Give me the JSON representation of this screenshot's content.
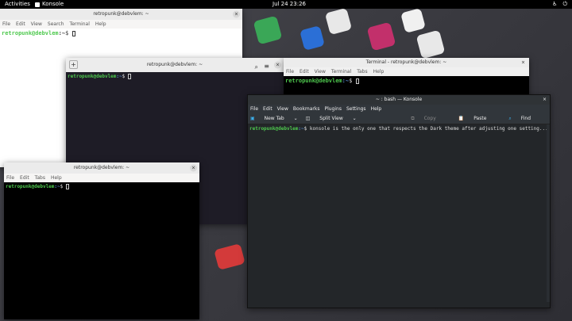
{
  "topbar": {
    "activities": "Activities",
    "app": "Konsole",
    "clock": "Jul 24  23:26"
  },
  "prompt": {
    "user": "retropunk@debvlem",
    "path": ":~",
    "sym": "$"
  },
  "win_top": {
    "title": "retropunk@debvlem: ~",
    "menu": [
      "File",
      "Edit",
      "View",
      "Search",
      "Terminal",
      "Help"
    ]
  },
  "win_mid": {
    "title": "retropunk@debvlem: ~"
  },
  "win_right": {
    "title": "Terminal - retropunk@debvlem: ~",
    "menu": [
      "File",
      "Edit",
      "View",
      "Terminal",
      "Tabs",
      "Help"
    ]
  },
  "win_bl": {
    "title": "retropunk@debvlem: ~",
    "menu": [
      "File",
      "Edit",
      "Tabs",
      "Help"
    ]
  },
  "konsole": {
    "title": "~ : bash — Konsole",
    "menu": [
      "File",
      "Edit",
      "View",
      "Bookmarks",
      "Plugins",
      "Settings",
      "Help"
    ],
    "new_tab": "New Tab",
    "split_view": "Split View",
    "copy": "Copy",
    "paste": "Paste",
    "find": "Find",
    "command": "konsole is the only one that respects the Dark theme after adjusting one setting..."
  }
}
